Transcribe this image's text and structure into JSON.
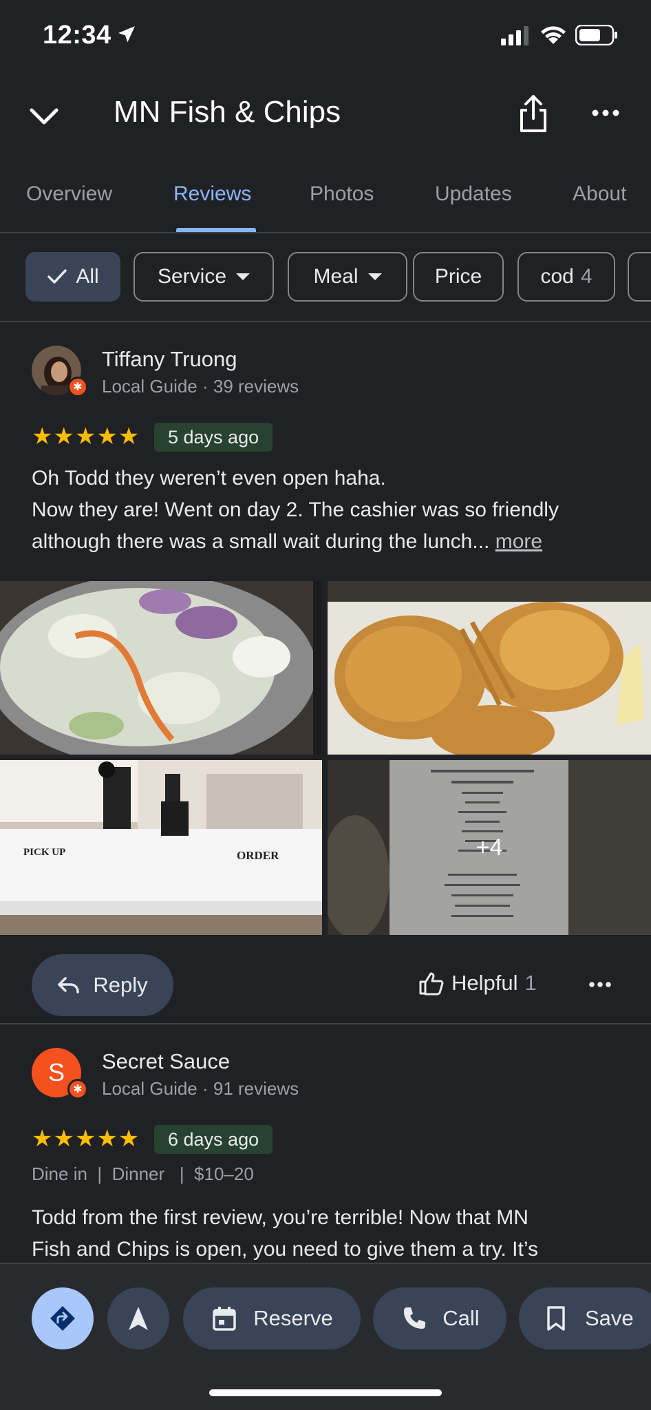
{
  "status": {
    "time": "12:34"
  },
  "header": {
    "title": "MN Fish & Chips"
  },
  "tabs": [
    "Overview",
    "Reviews",
    "Photos",
    "Updates",
    "About"
  ],
  "chips": [
    {
      "label": "All"
    },
    {
      "label": "Service"
    },
    {
      "label": "Meal"
    },
    {
      "label": "Price"
    },
    {
      "label": "cod",
      "count": "4"
    }
  ],
  "reviews": [
    {
      "name": "Tiffany Truong",
      "meta": "Local Guide · 39 reviews",
      "stars": "★★★★★",
      "date": "5 days ago",
      "text_lines": [
        "Oh Todd they weren’t even open haha.",
        "Now they are! Went on day 2. The cashier was so friendly",
        "although there was a small wait during the lunch..."
      ],
      "more_label": "more",
      "photo_overlay": "+4",
      "photo_labels": {
        "pick_up": "PICK UP",
        "order": "ORDER"
      },
      "reply_label": "Reply",
      "helpful_label": "Helpful",
      "helpful_count": "1"
    },
    {
      "name": "Secret Sauce",
      "avatar_letter": "S",
      "meta": "Local Guide · 91 reviews",
      "stars": "★★★★★",
      "date": "6 days ago",
      "tags": "Dine in  |  Dinner   |  $10–20",
      "text_lines": [
        "Todd  from the first review, you’re terrible! Now that MN",
        "Fish and Chips is open, you need to give them a try. It’s"
      ]
    }
  ],
  "bottom_actions": {
    "reserve": "Reserve",
    "call": "Call",
    "save": "Save"
  },
  "colors": {
    "accent": "#8ab4f8",
    "star": "#fbbc04",
    "badge": "#f4511e",
    "chip_active": "#394457"
  }
}
